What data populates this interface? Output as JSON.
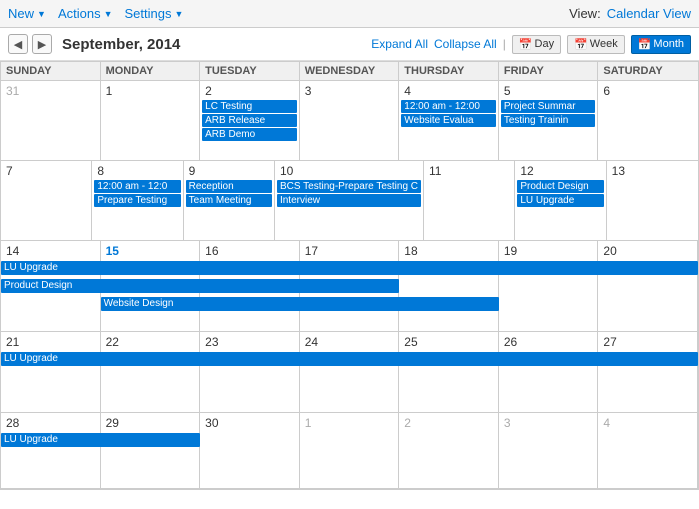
{
  "toolbar": {
    "new_label": "New",
    "actions_label": "Actions",
    "settings_label": "Settings",
    "view_prefix": "View:",
    "view_link": "Calendar View"
  },
  "nav": {
    "month_title": "September, 2014",
    "expand_all": "Expand All",
    "collapse_all": "Collapse All",
    "day_label": "Day",
    "week_label": "Week",
    "month_label": "Month"
  },
  "calendar": {
    "headers": [
      "SUNDAY",
      "MONDAY",
      "TUESDAY",
      "WEDNESDAY",
      "THURSDAY",
      "FRIDAY",
      "SATURDAY"
    ],
    "accent": "#0078d7"
  }
}
